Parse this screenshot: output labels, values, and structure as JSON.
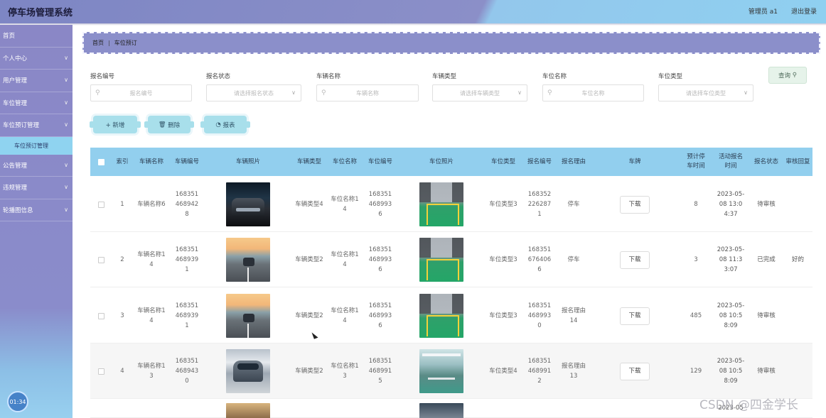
{
  "header": {
    "title": "停车场管理系统",
    "user": "管理员 a1",
    "logout": "退出登录"
  },
  "sidebar": {
    "items": [
      {
        "label": "首页",
        "chevron": false
      },
      {
        "label": "个人中心",
        "chevron": true
      },
      {
        "label": "用户管理",
        "chevron": true
      },
      {
        "label": "车位管理",
        "chevron": true
      },
      {
        "label": "车位预订管理",
        "chevron": true
      }
    ],
    "active_sub": "车位预订管理",
    "items_after": [
      {
        "label": "公告管理",
        "chevron": true
      },
      {
        "label": "违规管理",
        "chevron": true
      },
      {
        "label": "轮播图信息",
        "chevron": true
      }
    ],
    "clock": "01:34"
  },
  "breadcrumb": [
    "首页",
    "车位预订"
  ],
  "filters": [
    {
      "label": "报名编号",
      "placeholder": "报名编号",
      "type": "text"
    },
    {
      "label": "报名状态",
      "placeholder": "请选择报名状态",
      "type": "select"
    },
    {
      "label": "车辆名称",
      "placeholder": "车辆名称",
      "type": "text"
    },
    {
      "label": "车辆类型",
      "placeholder": "请选择车辆类型",
      "type": "select"
    },
    {
      "label": "车位名称",
      "placeholder": "车位名称",
      "type": "text"
    },
    {
      "label": "车位类型",
      "placeholder": "请选择车位类型",
      "type": "select"
    }
  ],
  "query_label": "查询",
  "actions": {
    "add": "+ 新增",
    "delete": "删除",
    "report": "报表"
  },
  "table": {
    "headers": [
      "索引",
      "车辆名称",
      "车辆编号",
      "车辆照片",
      "车辆类型",
      "车位名称",
      "车位编号",
      "车位照片",
      "车位类型",
      "报名编号",
      "报名理由",
      "车牌",
      "预计停车时间",
      "活动报名时间",
      "报名状态",
      "审核回复"
    ],
    "download_label": "下载",
    "rows": [
      {
        "index": "1",
        "vehicle_name": "车辆名称6",
        "vehicle_no": "1683514689428",
        "car_photo": "car-dark",
        "vehicle_type": "车辆类型4",
        "space_name": "车位名称14",
        "space_no": "1683514689936",
        "space_photo": "spot-green",
        "space_type": "车位类型3",
        "apply_no": "1683522262871",
        "reason": "停车",
        "hours": "8",
        "apply_time": "2023-05-08 13:04:37",
        "status": "待审核",
        "reply": ""
      },
      {
        "index": "2",
        "vehicle_name": "车辆名称14",
        "vehicle_no": "1683514689391",
        "car_photo": "car-road",
        "vehicle_type": "车辆类型2",
        "space_name": "车位名称14",
        "space_no": "1683514689936",
        "space_photo": "spot-green",
        "space_type": "车位类型3",
        "apply_no": "1683516764066",
        "reason": "停车",
        "hours": "3",
        "apply_time": "2023-05-08 11:33:07",
        "status": "已完成",
        "reply": "好的"
      },
      {
        "index": "3",
        "vehicle_name": "车辆名称14",
        "vehicle_no": "1683514689391",
        "car_photo": "car-road",
        "vehicle_type": "车辆类型2",
        "space_name": "车位名称14",
        "space_no": "1683514689936",
        "space_photo": "spot-green",
        "space_type": "车位类型3",
        "apply_no": "1683514689930",
        "reason": "报名理由14",
        "hours": "485",
        "apply_time": "2023-05-08 10:58:09",
        "status": "待审核",
        "reply": ""
      },
      {
        "index": "4",
        "vehicle_name": "车辆名称13",
        "vehicle_no": "1683514689430",
        "car_photo": "car-silver",
        "vehicle_type": "车辆类型2",
        "space_name": "车位名称13",
        "space_no": "1683514689915",
        "space_photo": "spot-hall",
        "space_type": "车位类型4",
        "apply_no": "1683514689912",
        "reason": "报名理由13",
        "hours": "129",
        "apply_time": "2023-05-08 10:58:09",
        "status": "待审核",
        "reply": ""
      },
      {
        "index": "",
        "vehicle_name": "",
        "vehicle_no": "",
        "car_photo": "car-peek",
        "vehicle_type": "",
        "space_name": "",
        "space_no": "",
        "space_photo": "spot-peek",
        "space_type": "",
        "apply_no": "",
        "reason": "",
        "hours": "",
        "apply_time": "2023-05",
        "status": "",
        "reply": ""
      }
    ]
  },
  "watermark": "CSDN @四金学长"
}
